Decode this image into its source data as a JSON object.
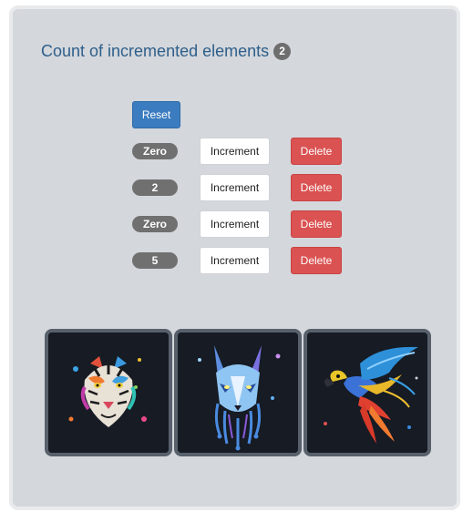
{
  "heading": {
    "title": "Count of incremented elements",
    "count": "2"
  },
  "reset_label": "Reset",
  "counters": [
    {
      "badge": "Zero",
      "increment_label": "Increment",
      "delete_label": "Delete"
    },
    {
      "badge": "2",
      "increment_label": "Increment",
      "delete_label": "Delete"
    },
    {
      "badge": "Zero",
      "increment_label": "Increment",
      "delete_label": "Delete"
    },
    {
      "badge": "5",
      "increment_label": "Increment",
      "delete_label": "Delete"
    }
  ],
  "gallery": [
    {
      "icon": "tiger-image"
    },
    {
      "icon": "wolf-image"
    },
    {
      "icon": "parrot-image"
    }
  ],
  "colors": {
    "panel_bg": "#d4d7dc",
    "heading": "#2e5f8a",
    "badge": "#707070",
    "reset_button": "#3b7cc0",
    "delete_button": "#da5252",
    "tile_border": "#57606b"
  }
}
